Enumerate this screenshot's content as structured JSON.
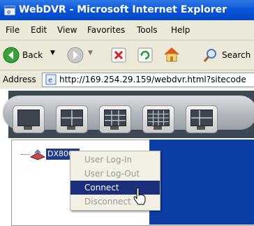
{
  "window": {
    "title": "WebDVR - Microsoft Internet Explorer",
    "titlebar_color": "#0a54d6"
  },
  "menubar": {
    "items": [
      "File",
      "Edit",
      "View",
      "Favorites",
      "Tools",
      "Help"
    ]
  },
  "toolbar": {
    "back_label": "Back",
    "search_label": "Search",
    "icons": [
      "back-icon",
      "forward-icon",
      "stop-icon",
      "refresh-icon",
      "home-icon",
      "search-icon"
    ]
  },
  "address_bar": {
    "label": "Address",
    "url": "http://169.254.29.159/webdvr.html?sitecode"
  },
  "viewer_toolbar": {
    "buttons": [
      "layout-1-icon",
      "layout-4-icon",
      "layout-9-icon",
      "layout-16-icon",
      "layout-more-icon"
    ]
  },
  "tree": {
    "node_label": "DX8000",
    "selection_color": "#1f3a8a"
  },
  "context_menu": {
    "items": [
      {
        "label": "User Log-In",
        "enabled": false
      },
      {
        "label": "User Log-Out",
        "enabled": false
      },
      {
        "label": "Connect",
        "enabled": true,
        "highlighted": true
      },
      {
        "label": "Disconnect",
        "enabled": false
      }
    ],
    "highlight_color": "#1c2f7c"
  }
}
